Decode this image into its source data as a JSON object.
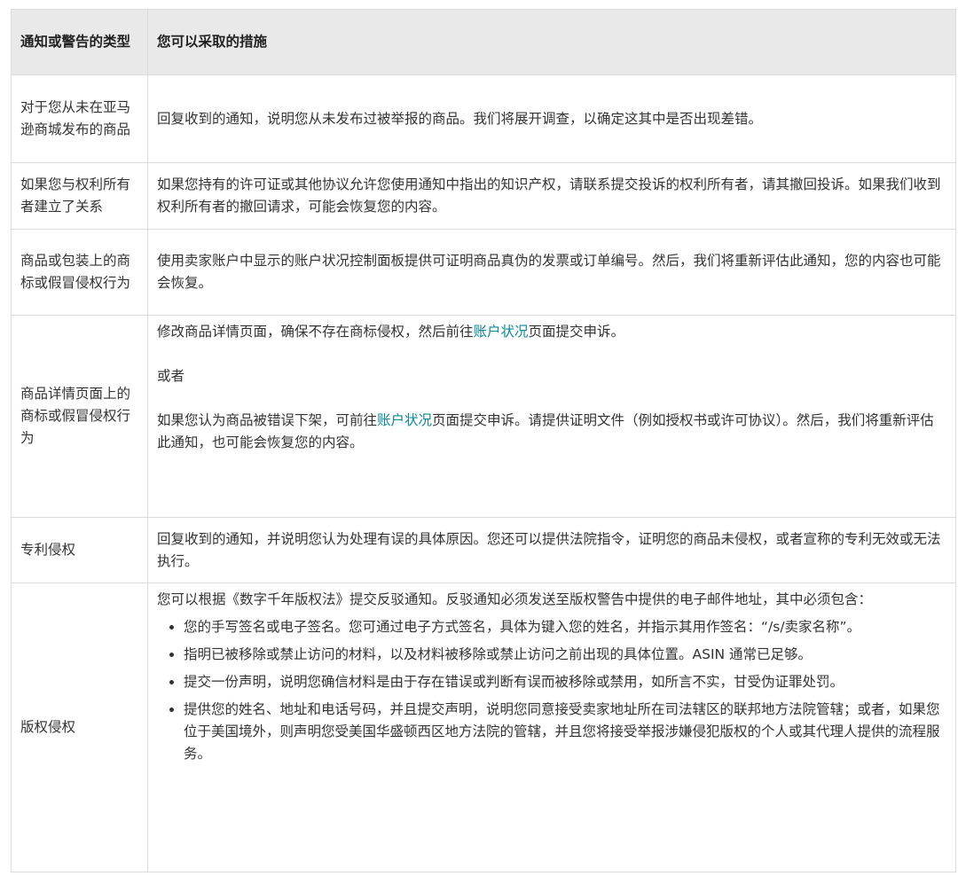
{
  "header": {
    "col1": "通知或警告的类型",
    "col2": "您可以采取的措施"
  },
  "rows": [
    {
      "type": "对于您从未在亚马逊商城发布的商品",
      "action": "回复收到的通知，说明您从未发布过被举报的商品。我们将展开调查，以确定这其中是否出现差错。"
    },
    {
      "type": "如果您与权利所有者建立了关系",
      "action": "如果您持有的许可证或其他协议允许您使用通知中指出的知识产权，请联系提交投诉的权利所有者，请其撤回投诉。如果我们收到权利所有者的撤回请求，可能会恢复您的内容。"
    },
    {
      "type": "商品或包装上的商标或假冒侵权行为",
      "action": "使用卖家账户中显示的账户状况控制面板提供可证明商品真伪的发票或订单编号。然后，我们将重新评估此通知，您的内容也可能会恢复。"
    },
    {
      "type": "商品详情页面上的商标或假冒侵权行为",
      "p1_before": "修改商品详情页面，确保不存在商标侵权，然后前往",
      "p1_link": "账户状况",
      "p1_after": "页面提交申诉。",
      "or": "或者",
      "p2_before": "如果您认为商品被错误下架，可前往",
      "p2_link": "账户状况",
      "p2_after": "页面提交申诉。请提供证明文件（例如授权书或许可协议）。然后，我们将重新评估此通知，也可能会恢复您的内容。"
    },
    {
      "type": "专利侵权",
      "action": "回复收到的通知，并说明您认为处理有误的具体原因。您还可以提供法院指令，证明您的商品未侵权，或者宣称的专利无效或无法执行。"
    },
    {
      "type": "版权侵权",
      "intro": "您可以根据《数字千年版权法》提交反驳通知。反驳通知必须发送至版权警告中提供的电子邮件地址，其中必须包含：",
      "bullets": [
        "您的手写签名或电子签名。您可通过电子方式签名，具体为键入您的姓名，并指示其用作签名：“/s/卖家名称”。",
        "指明已被移除或禁止访问的材料，以及材料被移除或禁止访问之前出现的具体位置。ASIN 通常已足够。",
        "提交一份声明，说明您确信材料是由于存在错误或判断有误而被移除或禁用，如所言不实，甘受伪证罪处罚。",
        "提供您的姓名、地址和电话号码，并且提交声明，说明您同意接受卖家地址所在司法辖区的联邦地方法院管辖；或者，如果您位于美国境外，则声明您受美国华盛顿西区地方法院的管辖，并且您将接受举报涉嫌侵犯版权的个人或其代理人提供的流程服务。"
      ]
    }
  ]
}
